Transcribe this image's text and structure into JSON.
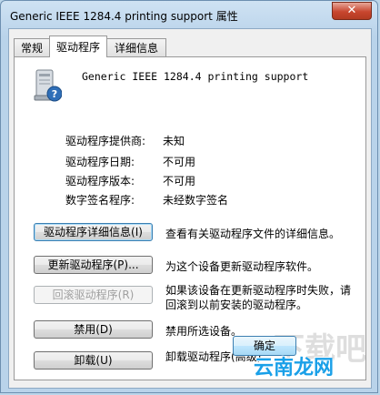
{
  "window": {
    "title": "Generic IEEE 1284.4 printing support 属性",
    "close_label": "✕"
  },
  "tabs": [
    {
      "label": "常规",
      "active": false
    },
    {
      "label": "驱动程序",
      "active": true
    },
    {
      "label": "详细信息",
      "active": false
    }
  ],
  "device": {
    "name": "Generic IEEE 1284.4 printing support",
    "icon": "printer-device-icon"
  },
  "info": [
    {
      "label": "驱动程序提供商:",
      "value": "未知"
    },
    {
      "label": "驱动程序日期:",
      "value": "不可用"
    },
    {
      "label": "驱动程序版本:",
      "value": "不可用"
    },
    {
      "label": "数字签名程序:",
      "value": "未经数字签名"
    }
  ],
  "actions": [
    {
      "button": "驱动程序详细信息(I)",
      "description": "查看有关驱动程序文件的详细信息。",
      "enabled": true
    },
    {
      "button": "更新驱动程序(P)...",
      "description": "为这个设备更新驱动程序软件。",
      "enabled": true
    },
    {
      "button": "回滚驱动程序(R)",
      "description": "如果该设备在更新驱动程序时失败，请回滚到以前安装的驱动程序。",
      "enabled": false
    },
    {
      "button": "禁用(D)",
      "description": "禁用所选设备。",
      "enabled": true
    },
    {
      "button": "卸载(U)",
      "description": "卸载驱动程序(高级)。",
      "enabled": true
    }
  ],
  "footer": {
    "ok_label": "确定"
  },
  "watermark": {
    "text": "云南龙网",
    "faint_text": "下载吧"
  },
  "colors": {
    "accent": "#3c7fb1",
    "close": "#c8462f",
    "watermark": "#1aa0e8"
  }
}
